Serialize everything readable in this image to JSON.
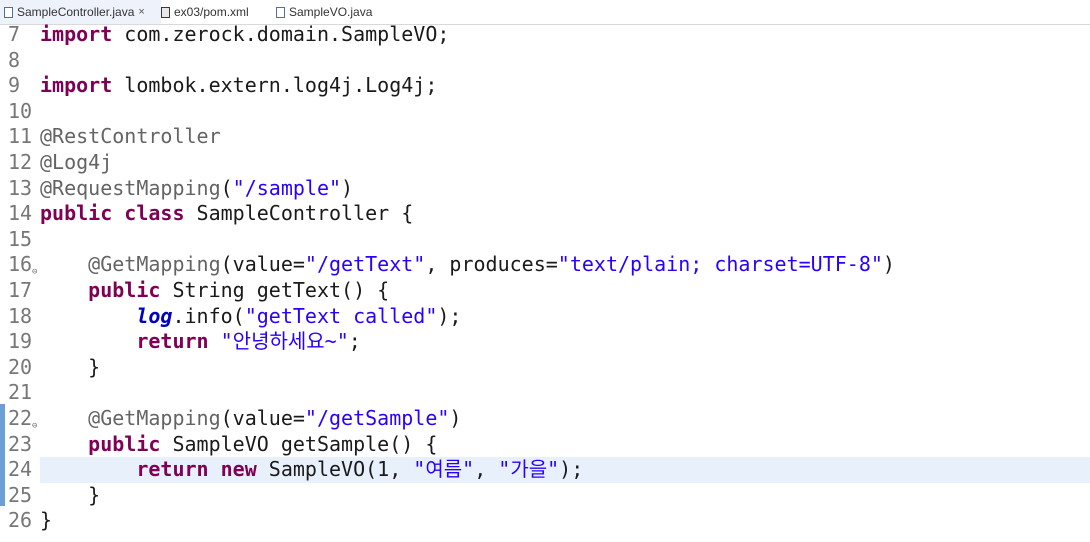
{
  "tabs": [
    {
      "label": "SampleController.java",
      "close": "×"
    },
    {
      "label": "ex03/pom.xml"
    },
    {
      "label": "SampleVO.java"
    }
  ],
  "lines": {
    "l7": {
      "n": "7",
      "t1": "import",
      "t2": " com.zerock.domain.SampleVO;"
    },
    "l8": {
      "n": "8"
    },
    "l9": {
      "n": "9",
      "t1": "import",
      "t2": " lombok.extern.log4j.Log4j;"
    },
    "l10": {
      "n": "10"
    },
    "l11": {
      "n": "11",
      "t1": "@RestController"
    },
    "l12": {
      "n": "12",
      "t1": "@Log4j"
    },
    "l13": {
      "n": "13",
      "t1": "@RequestMapping",
      "t2": "(",
      "t3": "\"/sample\"",
      "t4": ")"
    },
    "l14": {
      "n": "14",
      "t1": "public",
      "t2": " ",
      "t3": "class",
      "t4": " SampleController {"
    },
    "l15": {
      "n": "15"
    },
    "l16": {
      "n": "16",
      "t1": "    ",
      "t2": "@GetMapping",
      "t3": "(value=",
      "t4": "\"/getText\"",
      "t5": ", produces=",
      "t6": "\"text/plain; charset=UTF-8\"",
      "t7": ")"
    },
    "l17": {
      "n": "17",
      "t1": "    ",
      "t2": "public",
      "t3": " String getText() {"
    },
    "l18": {
      "n": "18",
      "t1": "        ",
      "t2": "log",
      "t3": ".info(",
      "t4": "\"getText called\"",
      "t5": ");"
    },
    "l19": {
      "n": "19",
      "t1": "        ",
      "t2": "return",
      "t3": " ",
      "t4": "\"안녕하세요~\"",
      "t5": ";"
    },
    "l20": {
      "n": "20",
      "t1": "    }"
    },
    "l21": {
      "n": "21"
    },
    "l22": {
      "n": "22",
      "t1": "    ",
      "t2": "@GetMapping",
      "t3": "(value=",
      "t4": "\"/getSample\"",
      "t5": ")"
    },
    "l23": {
      "n": "23",
      "t1": "    ",
      "t2": "public",
      "t3": " SampleVO getSample() {"
    },
    "l24": {
      "n": "24",
      "t1": "        ",
      "t2": "return",
      "t3": " ",
      "t4": "new",
      "t5": " SampleVO(1, ",
      "t6": "\"여름\"",
      "t7": ", ",
      "t8": "\"가을\"",
      "t9": ");"
    },
    "l25": {
      "n": "25",
      "t1": "    }"
    },
    "l26": {
      "n": "26",
      "t1": "}"
    }
  },
  "colors": {
    "keyword": "#7f0055",
    "annotation": "#646464",
    "string": "#2a00ff",
    "static_field": "#0000c0",
    "current_line": "#e8f1fb",
    "change_marker": "#6c9fd6"
  }
}
